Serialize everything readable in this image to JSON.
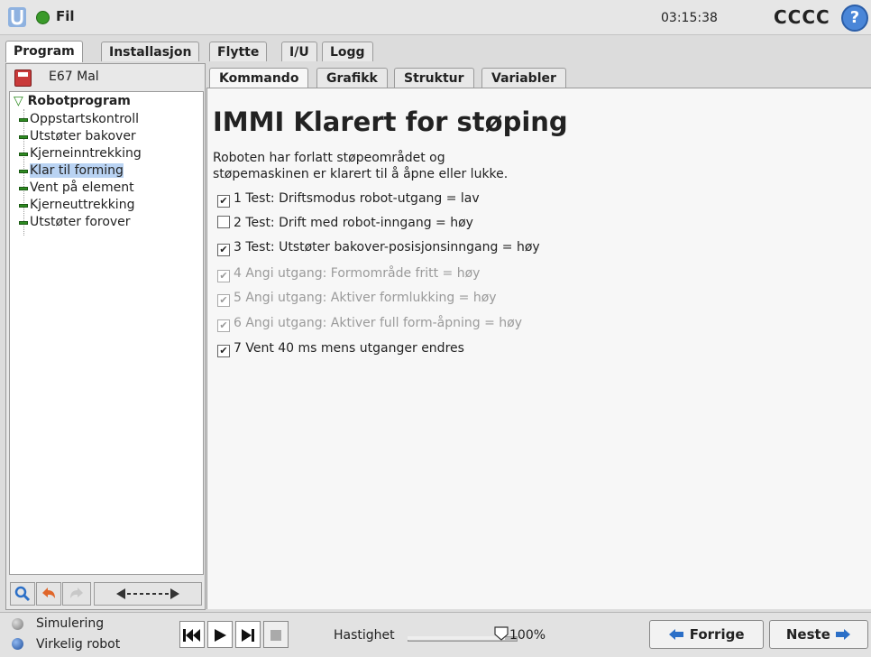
{
  "header": {
    "file_label": "Fil",
    "clock": "03:15:38",
    "robot_name": "CCCC",
    "help_glyph": "?"
  },
  "main_tabs": [
    {
      "label": "Program"
    },
    {
      "label": "Installasjon"
    },
    {
      "label": "Flytte"
    },
    {
      "label": "I/U"
    },
    {
      "label": "Logg"
    }
  ],
  "program": {
    "name": "E67 Mal"
  },
  "tree": {
    "root": "Robotprogram",
    "items": [
      {
        "label": "Oppstartskontroll"
      },
      {
        "label": "Utstøter bakover"
      },
      {
        "label": "Kjerneinntrekking"
      },
      {
        "label": "Klar til forming"
      },
      {
        "label": "Vent på element"
      },
      {
        "label": "Kjerneuttrekking"
      },
      {
        "label": "Utstøter forover"
      }
    ]
  },
  "sub_tabs": [
    {
      "label": "Kommando"
    },
    {
      "label": "Grafikk"
    },
    {
      "label": "Struktur"
    },
    {
      "label": "Variabler"
    }
  ],
  "content": {
    "title": "IMMI Klarert for støping",
    "desc_line1": "Roboten har forlatt støpeområdet og",
    "desc_line2": "støpemaskinen er klarert til å åpne eller lukke.",
    "checks": [
      {
        "label": "1 Test: Driftsmodus robot-utgang = lav",
        "checked": true,
        "enabled": true
      },
      {
        "label": "2 Test: Drift med robot-inngang = høy",
        "checked": false,
        "enabled": true
      },
      {
        "label": "3 Test: Utstøter bakover-posisjonsinngang = høy",
        "checked": true,
        "enabled": true
      },
      {
        "label": "4 Angi utgang: Formområde fritt = høy",
        "checked": true,
        "enabled": false
      },
      {
        "label": "5 Angi utgang: Aktiver formlukking = høy",
        "checked": true,
        "enabled": false
      },
      {
        "label": "6 Angi utgang: Aktiver full form-åpning = høy",
        "checked": true,
        "enabled": false
      },
      {
        "label": "7 Vent 40 ms mens utganger endres",
        "checked": true,
        "enabled": true
      }
    ],
    "check_glyph": "✔"
  },
  "footer": {
    "sim_label": "Simulering",
    "real_label": "Virkelig robot",
    "speed_label": "Hastighet",
    "speed_value": "100%",
    "speed_fraction": 1.0,
    "prev_label": "Forrige",
    "next_label": "Neste"
  },
  "colors": {
    "accent_blue": "#4a86d8",
    "tree_bar": "#2e8b21",
    "selected": "#b9d3f3"
  }
}
